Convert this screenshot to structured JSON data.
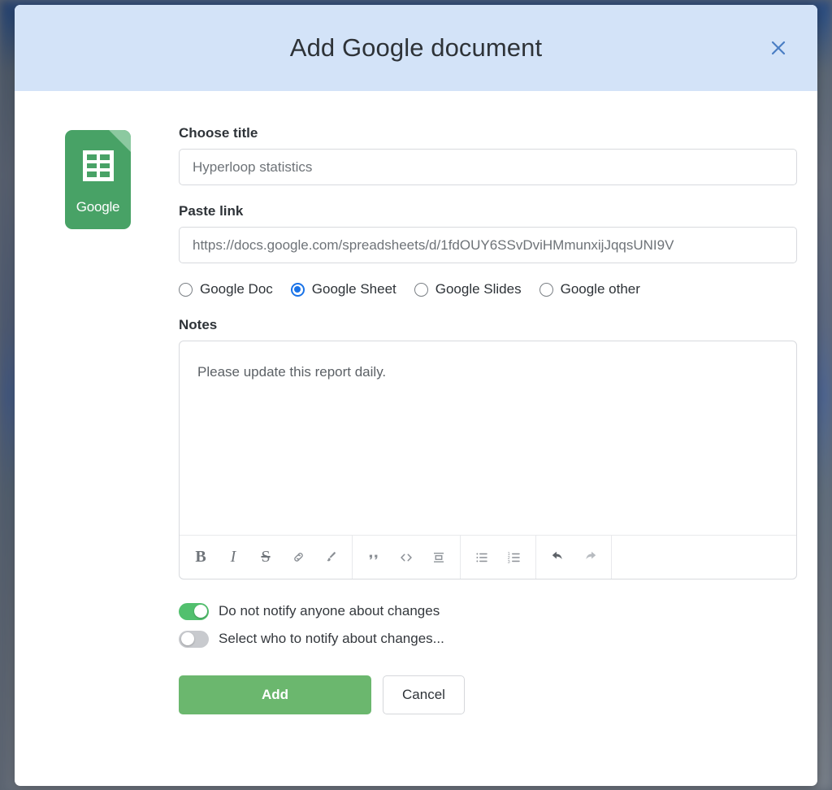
{
  "backdrop": {
    "color": "#5b6470"
  },
  "modal": {
    "title": "Add Google document",
    "close_icon": "close-icon",
    "header_color": "#d3e3f8",
    "doc_icon": {
      "type": "google-sheets-icon",
      "brand_label": "Google",
      "color": "#48a266"
    },
    "fields": {
      "title": {
        "label": "Choose title",
        "value": "Hyperloop statistics",
        "placeholder": "Hyperloop statistics"
      },
      "link": {
        "label": "Paste link",
        "value": "https://docs.google.com/spreadsheets/d/1fdOUY6SSvDviHMmunxijJqqsUNI9V",
        "placeholder": "https://docs.google.com/spreadsheets/d/1fdOUY6SSvDviHMmunxijJqqsUNI9V"
      },
      "notes": {
        "label": "Notes",
        "value": "Please update this report daily."
      }
    },
    "doc_type": {
      "selected": "Google Sheet",
      "accent_color": "#1a73e8",
      "options": [
        {
          "label": "Google Doc",
          "checked": false
        },
        {
          "label": "Google Sheet",
          "checked": true
        },
        {
          "label": "Google Slides",
          "checked": false
        },
        {
          "label": "Google other",
          "checked": false
        }
      ]
    },
    "editor_toolbar": {
      "groups": [
        [
          {
            "name": "bold-icon",
            "glyph": "B"
          },
          {
            "name": "italic-icon",
            "glyph": "I"
          },
          {
            "name": "strikethrough-icon",
            "glyph": "S"
          },
          {
            "name": "link-icon",
            "glyph": "link"
          },
          {
            "name": "brush-icon",
            "glyph": "brush"
          }
        ],
        [
          {
            "name": "blockquote-icon",
            "glyph": "quote"
          },
          {
            "name": "code-icon",
            "glyph": "<>"
          },
          {
            "name": "block-align-icon",
            "glyph": "block"
          }
        ],
        [
          {
            "name": "bullet-list-icon",
            "glyph": "bullets"
          },
          {
            "name": "numbered-list-icon",
            "glyph": "numbers"
          }
        ],
        [
          {
            "name": "undo-icon",
            "glyph": "undo"
          },
          {
            "name": "redo-icon",
            "glyph": "redo"
          }
        ]
      ]
    },
    "toggles": [
      {
        "label": "Do not notify anyone about changes",
        "on": true,
        "color": "#52c06e"
      },
      {
        "label": "Select who to notify about changes...",
        "on": false,
        "color": "#c8cace"
      }
    ],
    "actions": {
      "add_label": "Add",
      "add_color": "#6bb76e",
      "cancel_label": "Cancel"
    }
  }
}
